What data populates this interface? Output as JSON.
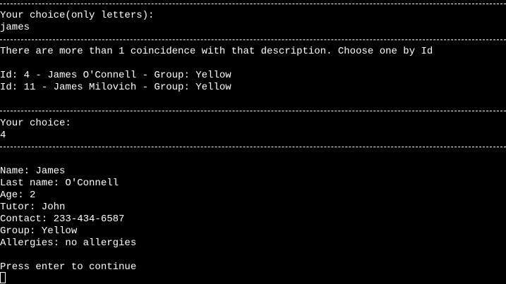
{
  "colors": {
    "background": "#000000",
    "foreground": "#ffffff"
  },
  "prompt_letters": {
    "label": "Your choice(only letters):",
    "value": "james"
  },
  "coincidence": {
    "message": "There are more than 1 coincidence with that description. Choose one by Id",
    "options": [
      "Id: 4 - James O'Connell - Group: Yellow",
      "Id: 11 - James Milovich - Group: Yellow"
    ]
  },
  "prompt_choice": {
    "label": "Your choice:",
    "value": "4"
  },
  "details": {
    "name": "Name: James",
    "last_name": "Last name: O'Connell",
    "age": "Age: 2",
    "tutor": "Tutor: John",
    "contact": "Contact: 233-434-6587",
    "group": "Group: Yellow",
    "allergies": "Allergies: no allergies"
  },
  "footer": {
    "continue": "Press enter to continue"
  },
  "cursor_icon": "block-cursor-icon"
}
